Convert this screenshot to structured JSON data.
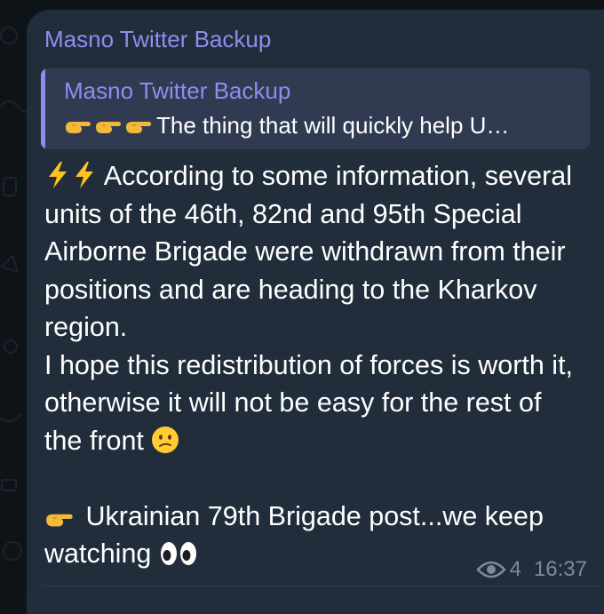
{
  "message": {
    "sender": "Masno Twitter Backup",
    "reply": {
      "title": "Masno Twitter Backup",
      "emoji_icons": [
        "pointing-hand-icon",
        "pointing-hand-icon",
        "pointing-hand-icon"
      ],
      "text": "The thing that will quickly help U…"
    },
    "body": {
      "lead_emoji": [
        "lightning-icon",
        "lightning-icon"
      ],
      "paragraph1": "According to some information, several units of the 46th, 82nd and 95th Special Airborne Brigade were withdrawn from their positions and are heading to the Kharkov region.",
      "paragraph2": "I hope this redistribution of forces is worth it, otherwise it will not be easy for the rest of the front",
      "paragraph2_emoji": "confused-face-icon",
      "paragraph3_emoji": "pointing-hand-icon",
      "paragraph3": "Ukrainian 79th Brigade post...we keep watching",
      "paragraph3_trailing_emoji": "eyes-icon"
    },
    "views": "4",
    "time": "16:37"
  },
  "colors": {
    "background": "#0e1318",
    "bubble": "#212d3b",
    "accent": "#8b8ff0",
    "reply_background": "#303b51",
    "meta": "#7d8b99",
    "text": "#ffffff"
  }
}
